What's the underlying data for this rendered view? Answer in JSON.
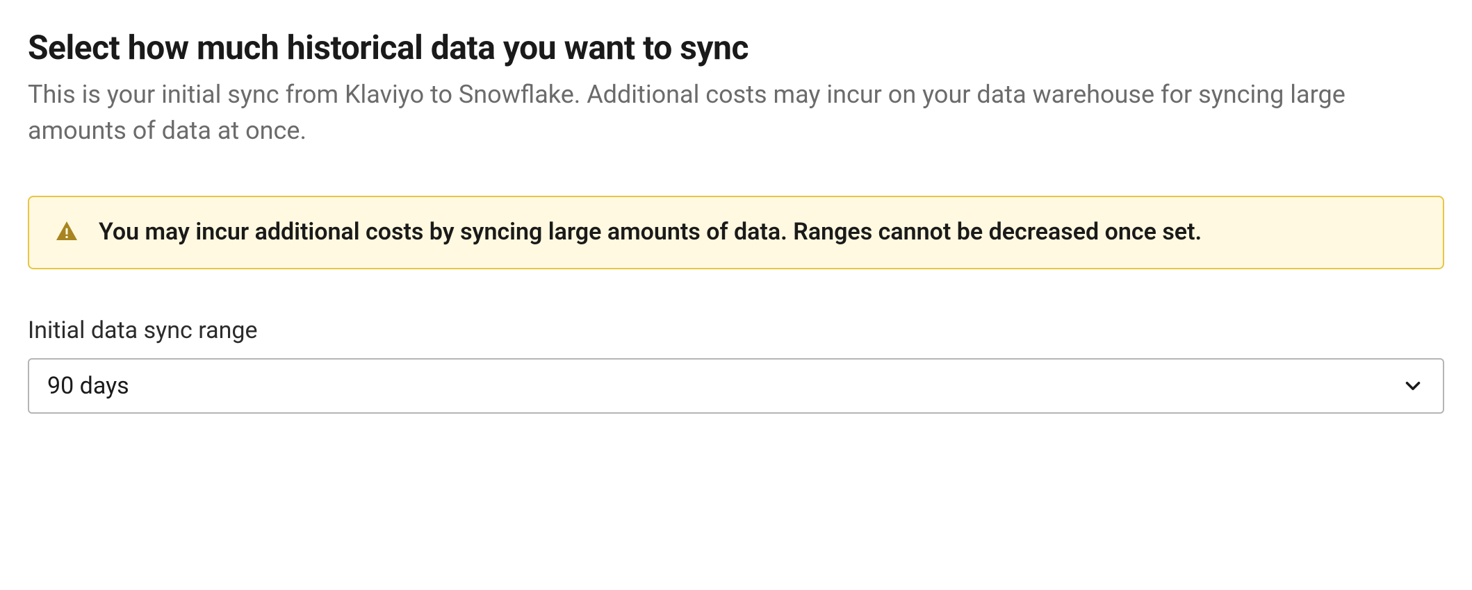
{
  "header": {
    "title": "Select how much historical data you want to sync",
    "description": "This is your initial sync from Klaviyo to Snowflake. Additional costs may incur on your data warehouse for syncing large amounts of data at once."
  },
  "alert": {
    "message": "You may incur additional costs by syncing large amounts of data. Ranges cannot be decreased once set."
  },
  "form": {
    "range_label": "Initial data sync range",
    "range_value": "90 days"
  },
  "colors": {
    "alert_bg": "#fef9e0",
    "alert_border": "#e8c544",
    "alert_icon": "#a7841f"
  }
}
